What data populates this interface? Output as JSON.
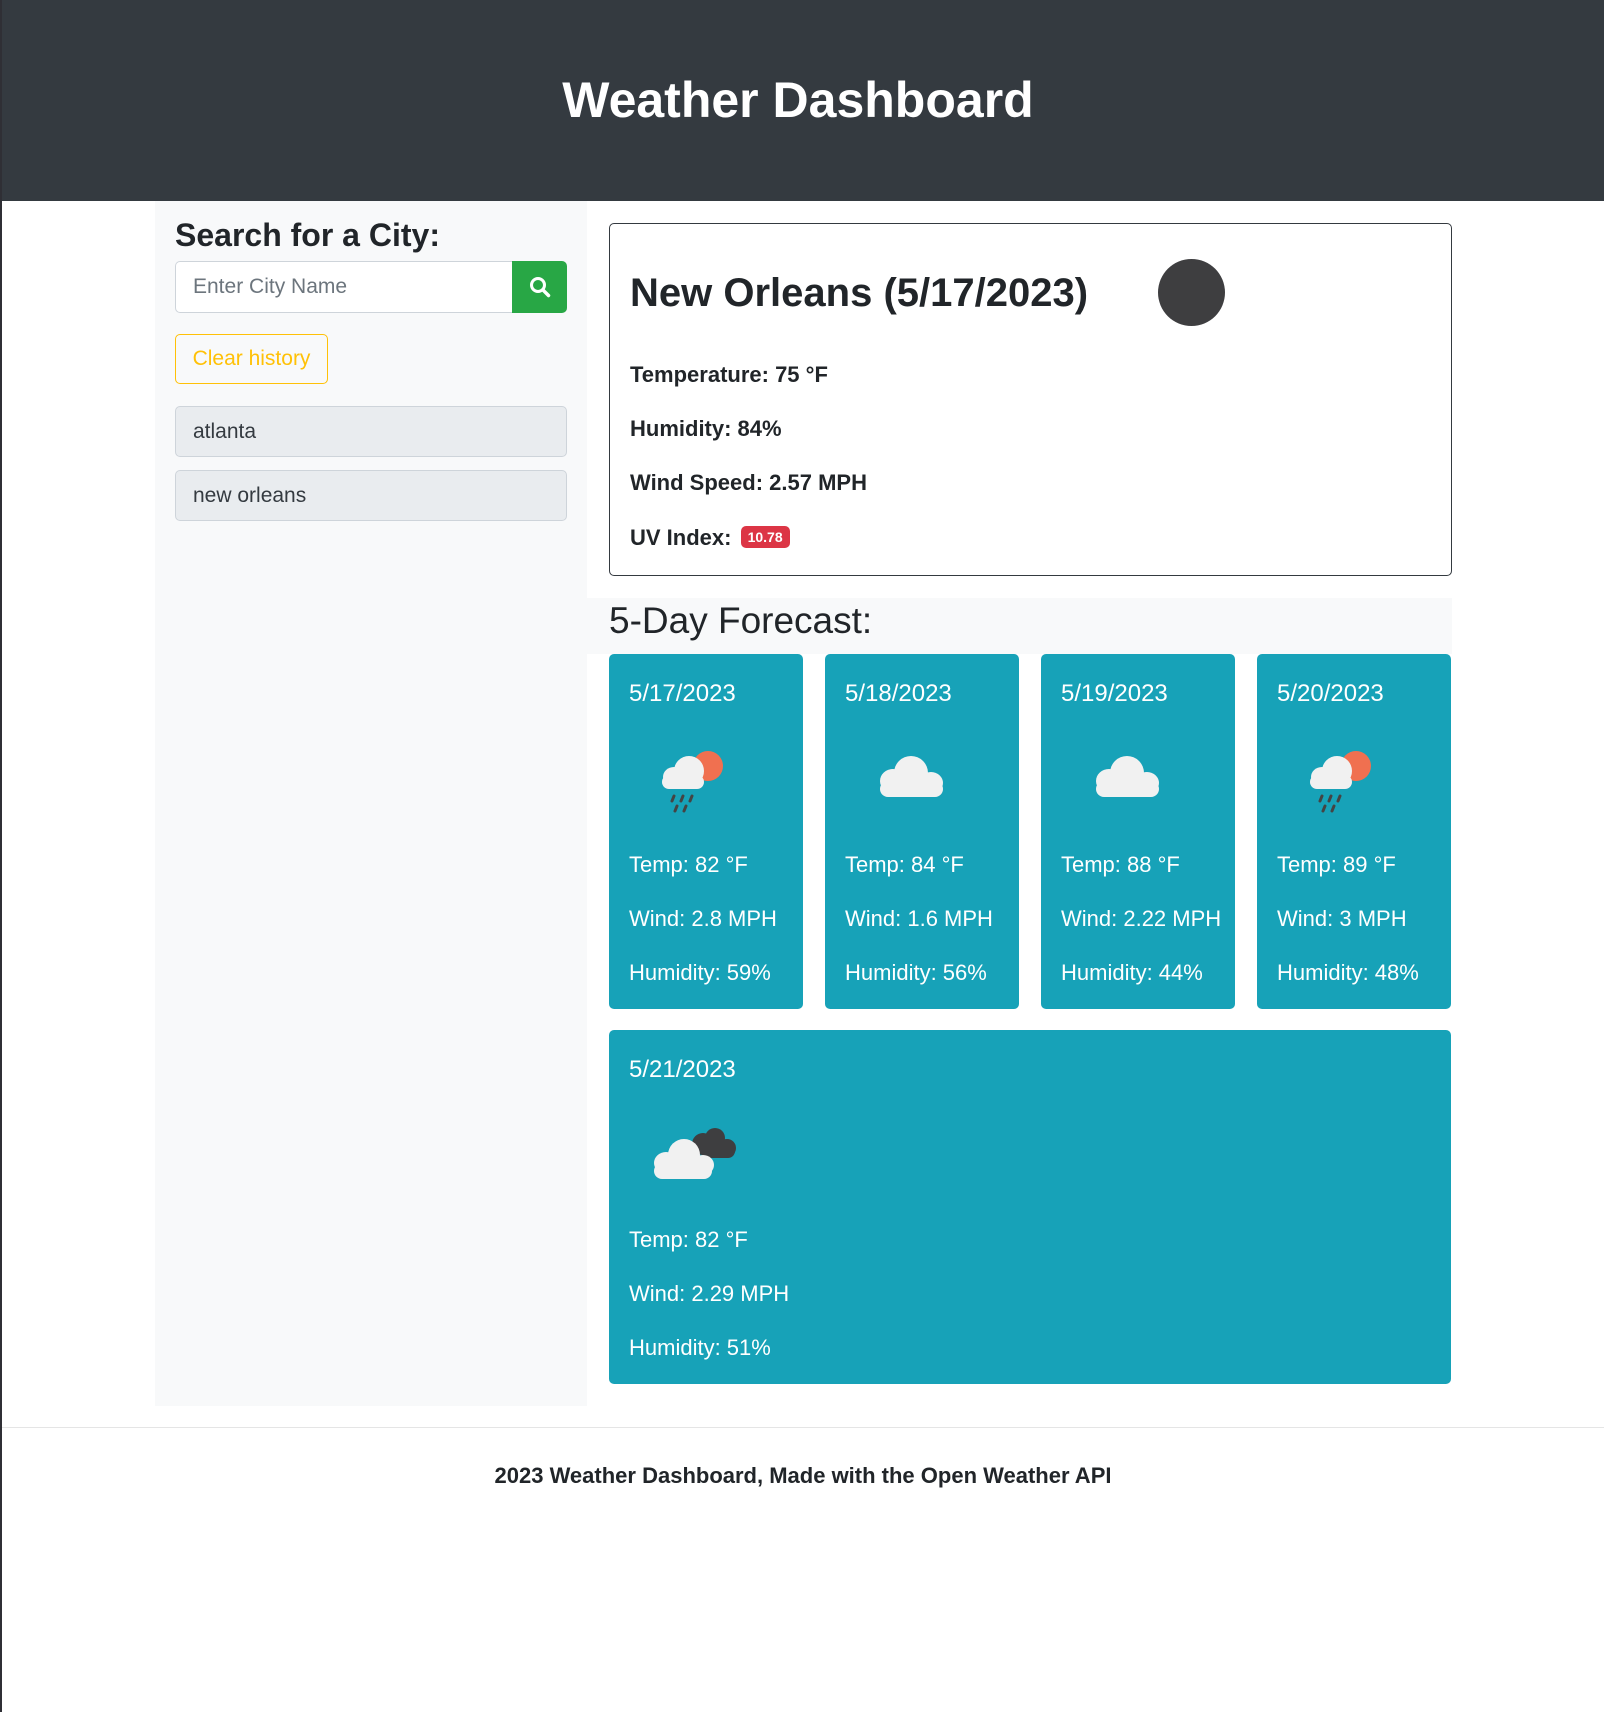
{
  "header": {
    "title": "Weather Dashboard"
  },
  "sidebar": {
    "heading": "Search for a City:",
    "search": {
      "placeholder": "Enter City Name",
      "value": ""
    },
    "search_icon": "search-icon",
    "clear_label": "Clear history",
    "history": [
      {
        "label": "atlanta"
      },
      {
        "label": "new orleans"
      }
    ]
  },
  "current": {
    "title": "New Orleans (5/17/2023)",
    "temperature": "Temperature: 75 °F",
    "humidity": "Humidity: 84%",
    "wind": "Wind Speed: 2.57 MPH",
    "uv_label": "UV Index:",
    "uv_value": "10.78",
    "uv_color": "#dc3545"
  },
  "forecast": {
    "title": "5-Day Forecast:",
    "days": [
      {
        "date": "5/17/2023",
        "icon": "rain-sun-icon",
        "temp": "Temp: 82 °F",
        "wind": "Wind: 2.8 MPH",
        "humidity": "Humidity: 59%"
      },
      {
        "date": "5/18/2023",
        "icon": "cloud-icon",
        "temp": "Temp: 84 °F",
        "wind": "Wind: 1.6 MPH",
        "humidity": "Humidity: 56%"
      },
      {
        "date": "5/19/2023",
        "icon": "cloud-icon",
        "temp": "Temp: 88 °F",
        "wind": "Wind: 2.22 MPH",
        "humidity": "Humidity: 44%"
      },
      {
        "date": "5/20/2023",
        "icon": "rain-sun-icon",
        "temp": "Temp: 89 °F",
        "wind": "Wind: 3 MPH",
        "humidity": "Humidity: 48%"
      },
      {
        "date": "5/21/2023",
        "icon": "broken-clouds-icon",
        "temp": "Temp: 82 °F",
        "wind": "Wind: 2.29 MPH",
        "humidity": "Humidity: 51%"
      }
    ]
  },
  "footer": {
    "text": "2023 Weather Dashboard, Made with the Open Weather API"
  },
  "colors": {
    "header_bg": "#343a40",
    "card_bg": "#17a2b8",
    "search_btn": "#28a745",
    "clear_btn": "#ffc107"
  }
}
